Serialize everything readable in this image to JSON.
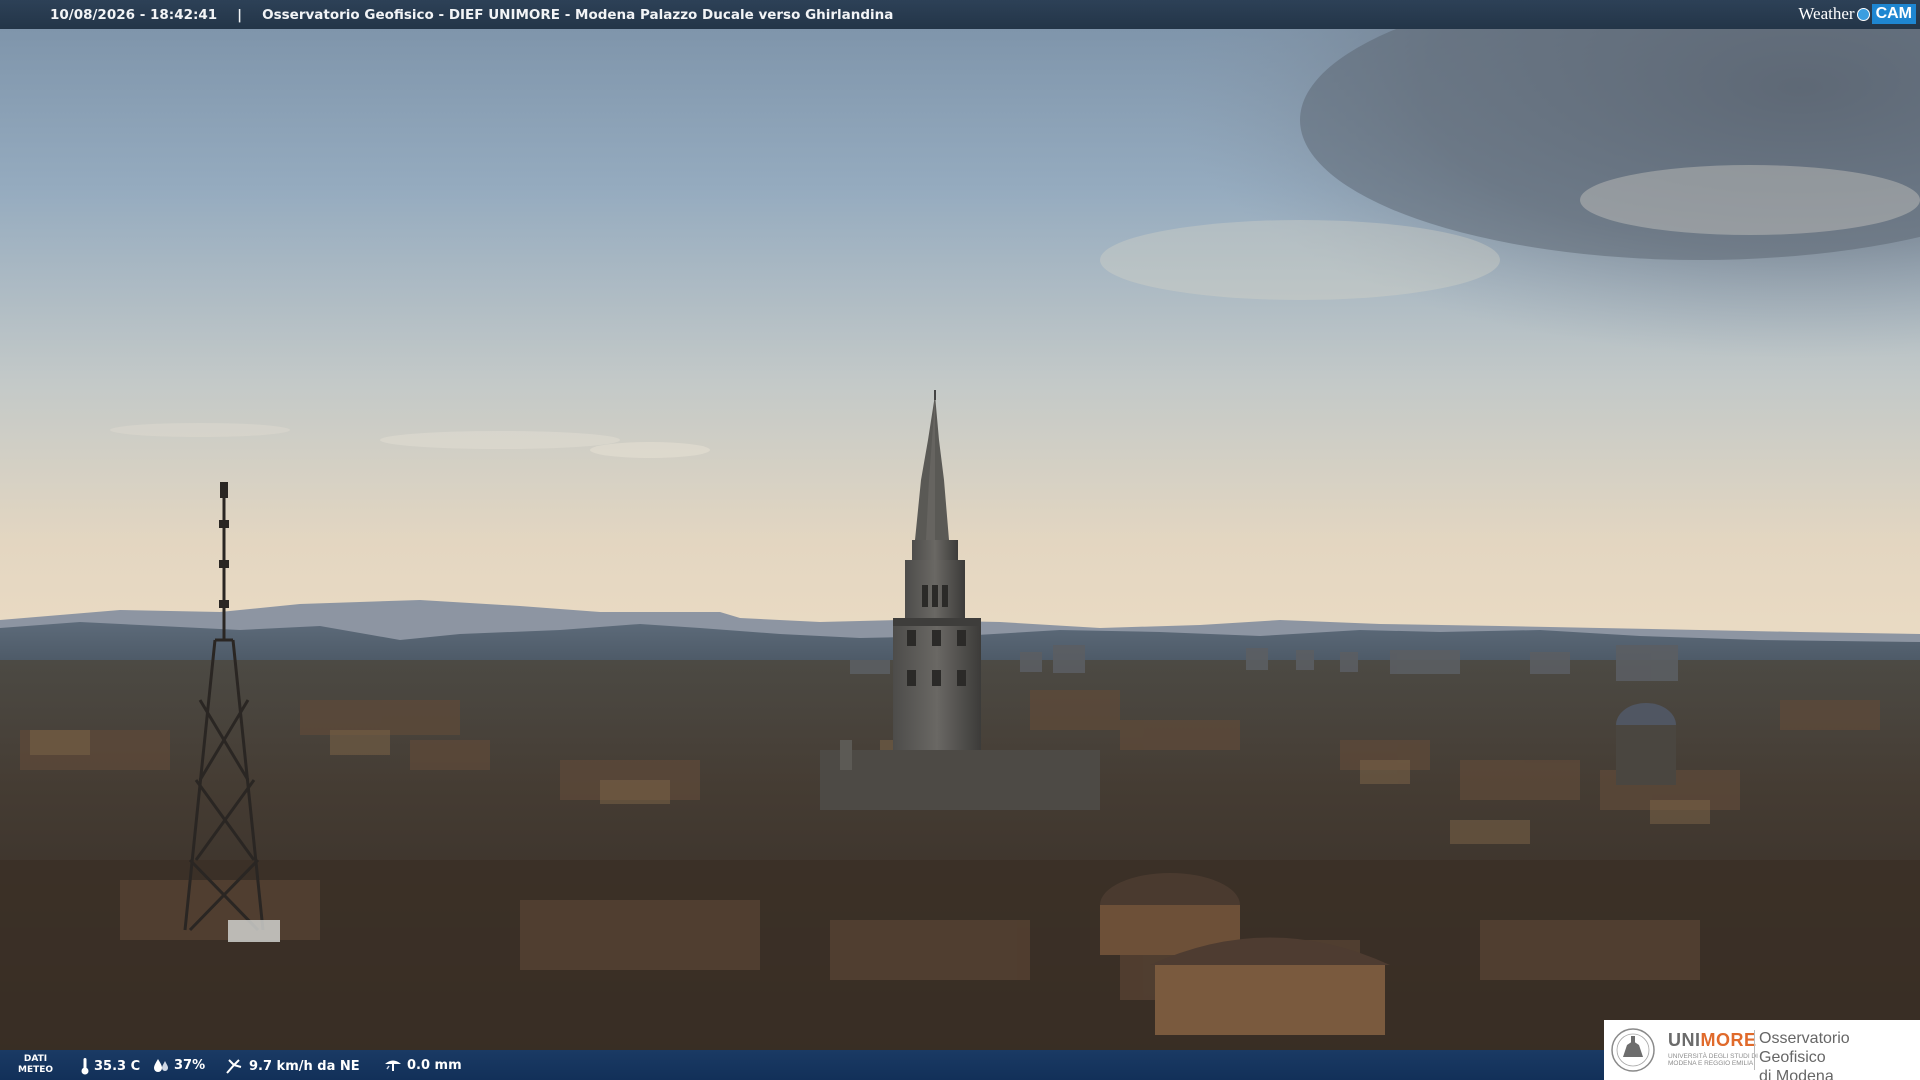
{
  "header": {
    "timestamp": "10/08/2026 - 18:42:41",
    "separator": "|",
    "location": "Osservatorio Geofisico - DIEF UNIMORE - Modena Palazzo Ducale verso Ghirlandina",
    "brand_weather": "Weather",
    "brand_cam": "CAM"
  },
  "weather": {
    "label_line1": "DATI",
    "label_line2": "METEO",
    "temperature": "35.3 C",
    "humidity": "37%",
    "wind": "9.7 km/h da NE",
    "rain": "0.0 mm"
  },
  "logo": {
    "uni_part1": "UNI",
    "uni_part2": "MORE",
    "uni_subtitle": "UNIVERSITÀ DEGLI STUDI DI MODENA E REGGIO EMILIA",
    "observatory_line1": "Osservatorio Geofisico",
    "observatory_line2": "di Modena"
  },
  "colors": {
    "topbar": "#2d4157",
    "bottombar": "#1a3a64",
    "unimore_accent": "#e06a2b",
    "brand_blue": "#1e86d1"
  },
  "icons": [
    "thermometer-icon",
    "humidity-drop-icon",
    "wind-icon",
    "rain-gauge-icon",
    "unimore-seal-icon"
  ]
}
